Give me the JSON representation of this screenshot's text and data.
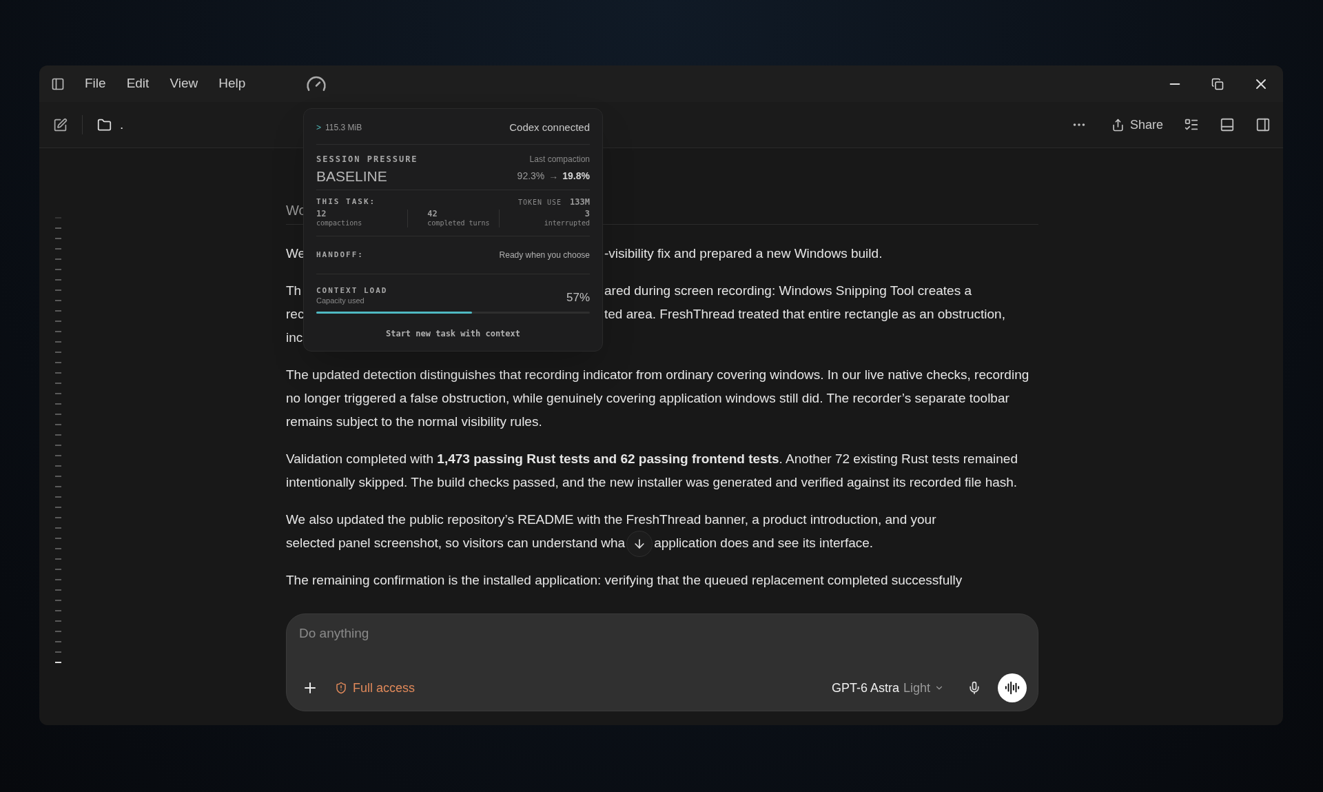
{
  "menu": {
    "items": [
      "File",
      "Edit",
      "View",
      "Help"
    ]
  },
  "toolbar": {
    "folder_label": ".",
    "share": "Share"
  },
  "status_popup": {
    "memory_prompt": ">",
    "memory": "115.3 MiB",
    "connection": "Codex connected",
    "session_label": "SESSION PRESSURE",
    "compaction_label": "Last compaction",
    "pressure": "BASELINE",
    "compaction_from": "92.3%",
    "compaction_arrow": "→",
    "compaction_to": "19.8%",
    "task_label": "THIS TASK:",
    "token_label": "TOKEN USE",
    "token_value": "133M",
    "stats": [
      {
        "value": "12",
        "label": "compactions"
      },
      {
        "value": "42",
        "label": "completed turns"
      },
      {
        "value": "3",
        "label": "interrupted"
      }
    ],
    "handoff_label": "HANDOFF:",
    "handoff_value": "Ready when you choose",
    "context_label": "CONTEXT LOAD",
    "capacity_label": "Capacity used",
    "capacity_value": "57%",
    "level": 0.57,
    "action": "Start new task with context"
  },
  "covered_lines": [
    {
      "kind": "heading",
      "left": "Wo"
    },
    {
      "kind": "line",
      "left": "We",
      "right": "-visibility fix and prepared a new Windows build."
    },
    {
      "kind": "line",
      "left": "Th",
      "right": "ared during screen recording: Windows Snipping Tool creates a"
    },
    {
      "kind": "line",
      "left": "rec",
      "right": "ted area. FreshThread treated that entire rectangle as an obstruction,"
    },
    {
      "kind": "line",
      "left": "inc"
    }
  ],
  "paragraphs": [
    "The updated detection distinguishes that recording indicator from ordinary covering windows. In our live native checks, recording no longer triggered a false obstruction, while genuinely covering application windows still did. The recorder’s separate toolbar remains subject to the normal visibility rules.",
    "Validation completed with **1,473 passing Rust tests and 62 passing frontend tests**. Another 72 existing Rust tests remained intentionally skipped. The build checks passed, and the new installer was generated and verified against its recorded file hash."
  ],
  "split_paragraph": {
    "first_line": "We also updated the public repository’s README with the FreshThread banner, a product introduction, and your",
    "before": "selected panel screenshot, so visitors can understand wha",
    "after": "application does and see its interface."
  },
  "last_line": "The remaining confirmation is the installed application: verifying that the queued replacement completed successfully",
  "composer": {
    "placeholder": "Do anything",
    "access": "Full access",
    "model": "GPT-6 Astra",
    "effort": "Light"
  }
}
